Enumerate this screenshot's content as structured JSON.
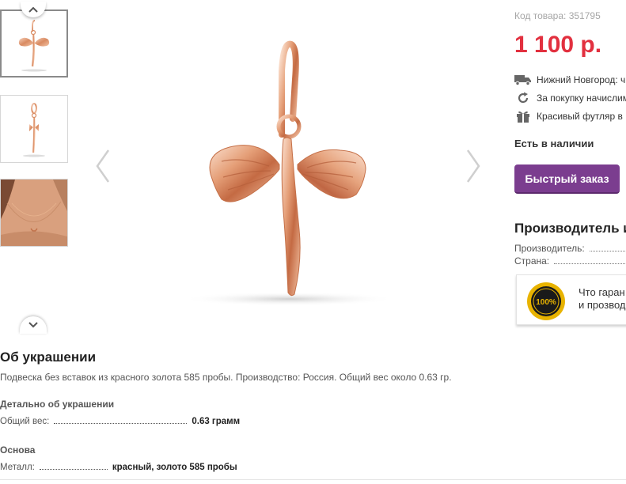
{
  "gallery": {
    "scroll_up_icon": "chevron-up-icon",
    "scroll_down_icon": "chevron-down-icon",
    "prev_icon": "chevron-left-icon",
    "next_icon": "chevron-right-icon",
    "thumbnails": [
      {
        "subject": "pendant-front"
      },
      {
        "subject": "pendant-side"
      },
      {
        "subject": "pendant-on-neck"
      }
    ]
  },
  "product": {
    "sku_label": "Код товара: 351795",
    "price": "1 100 р.",
    "delivery_text": "Нижний Новгород: ч",
    "bonus_text": "За покупку начислим",
    "gift_text": "Красивый футляр в п",
    "stock": "Есть в наличии",
    "quick_order": "Быстрый заказ",
    "price_color": "#e2303f",
    "button_color": "#7b3d8f"
  },
  "maker": {
    "title": "Производитель и",
    "manufacturer_label": "Производитель:",
    "country_label": "Страна:"
  },
  "guarantee": {
    "line1": "Что гаран",
    "line2": "и прозвод",
    "seal_text": "100%"
  },
  "about": {
    "title": "Об украшении",
    "text": "Подвеска без вставок из красного золота 585 пробы. Производство: Россия. Общий вес около 0.63 гр.",
    "details_title": "Детально об украшении",
    "weight_label": "Общий вес:",
    "weight_value": "0.63 грамм",
    "base_title": "Основа",
    "metal_label": "Металл:",
    "metal_value": "красный, золото 585 пробы"
  }
}
